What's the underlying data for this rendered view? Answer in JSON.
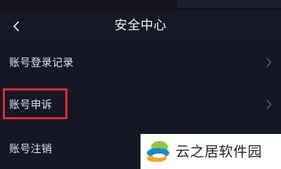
{
  "header": {
    "title": "安全中心",
    "back_icon": "chevron-left-icon"
  },
  "menu": {
    "items": [
      {
        "label": "账号登录记录",
        "icon": "chevron-right-icon"
      },
      {
        "label": "账号申诉",
        "icon": "chevron-right-icon"
      },
      {
        "label": "账号注销",
        "icon": "chevron-right-icon"
      }
    ]
  },
  "annotation": {
    "highlight_color": "#e02b34"
  },
  "watermark": {
    "text": "云之居软件园",
    "logo": "yunzhiju-logo"
  },
  "colors": {
    "background": "#161725",
    "text": "#e4e5ee",
    "chevron": "#5a5d6e"
  }
}
